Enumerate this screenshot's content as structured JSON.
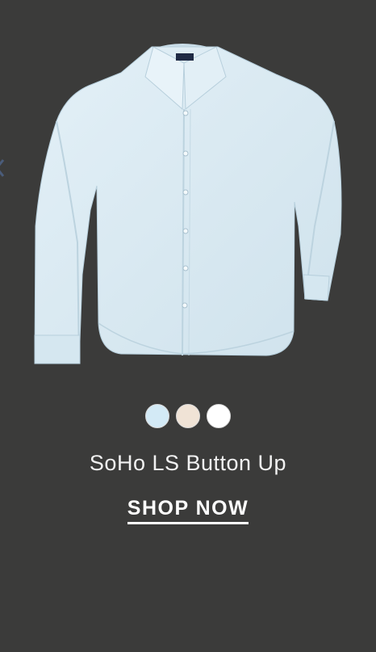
{
  "product": {
    "title": "SoHo LS Button Up",
    "cta_label": "SHOP NOW",
    "image_icon": "shirt-image",
    "shirt_color": "#d7e8f1",
    "swatches": [
      {
        "color": "#d3eaf6"
      },
      {
        "color": "#f0e3d6"
      },
      {
        "color": "#ffffff"
      }
    ]
  },
  "colors": {
    "background": "#3b3b3a",
    "text": "#f1f1f1"
  }
}
